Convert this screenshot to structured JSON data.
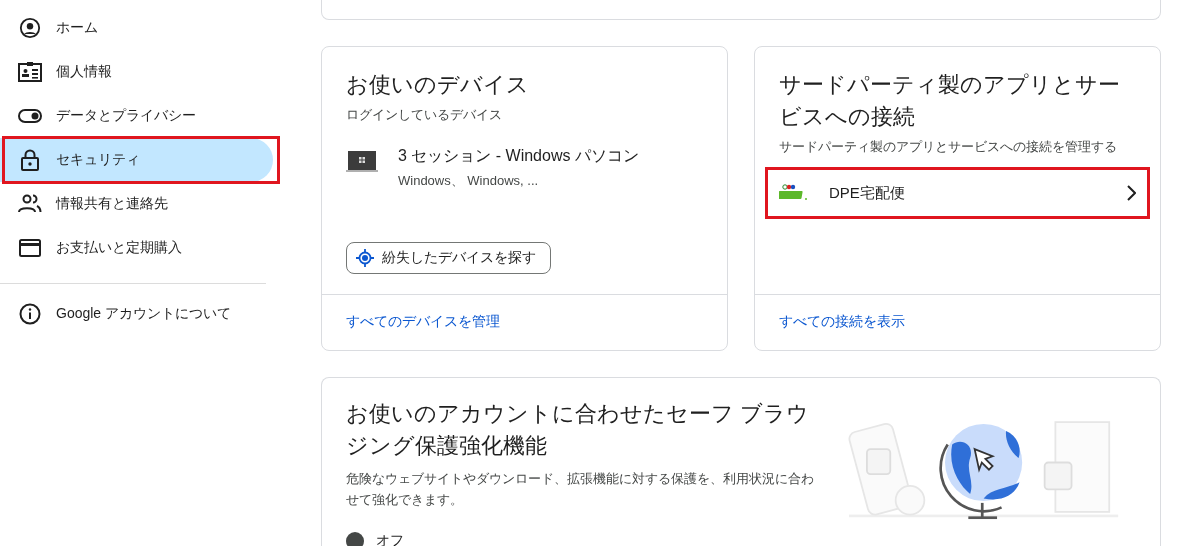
{
  "sidebar": {
    "items": [
      {
        "label": "ホーム",
        "kind": "home",
        "selected": false,
        "highlighted": false
      },
      {
        "label": "個人情報",
        "kind": "id",
        "selected": false,
        "highlighted": false
      },
      {
        "label": "データとプライバシー",
        "kind": "toggle",
        "selected": false,
        "highlighted": false
      },
      {
        "label": "セキュリティ",
        "kind": "lock",
        "selected": true,
        "highlighted": true
      },
      {
        "label": "情報共有と連絡先",
        "kind": "people",
        "selected": false,
        "highlighted": false
      },
      {
        "label": "お支払いと定期購入",
        "kind": "card",
        "selected": false,
        "highlighted": false
      }
    ],
    "about": {
      "label": "Google アカウントについて",
      "kind": "info"
    }
  },
  "devices_card": {
    "title": "お使いのデバイス",
    "subtitle": "ログインしているデバイス",
    "device": {
      "name": "3 セッション - Windows パソコン",
      "detail": "Windows、 Windows, ..."
    },
    "find_button": "紛失したデバイスを探す",
    "link": "すべてのデバイスを管理"
  },
  "connections_card": {
    "title": "サードパーティ製のアプリとサービスへの接続",
    "subtitle": "サードパーティ製のアプリとサービスへの接続を管理する",
    "apps": [
      {
        "name": "DPE宅配便",
        "highlighted": true
      }
    ],
    "link": "すべての接続を表示"
  },
  "safe_browsing_card": {
    "title": "お使いのアカウントに合わせたセーフ ブラウジング保護強化機能",
    "description": "危険なウェブサイトやダウンロード、拡張機能に対する保護を、利用状況に合わせて強化できます。",
    "status": "オフ"
  }
}
